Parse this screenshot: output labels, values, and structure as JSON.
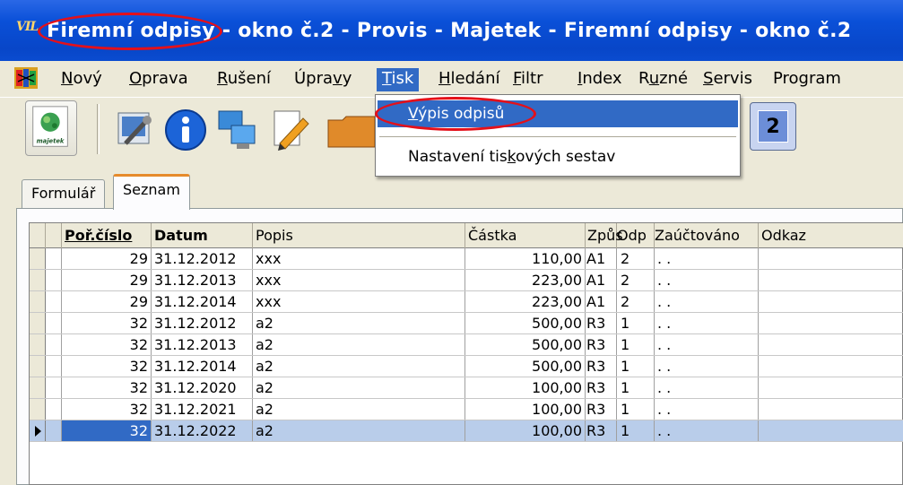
{
  "window": {
    "icon_text": "VIL",
    "title": "Firemní odpisy - okno č.2 - Provis - Majetek - Firemní odpisy - okno č.2"
  },
  "menubar": {
    "items": [
      {
        "label": "Nový"
      },
      {
        "label": "Oprava"
      },
      {
        "label": "Rušení"
      },
      {
        "label": "Úpravy"
      },
      {
        "label": "Tisk"
      },
      {
        "label": "Hledání"
      },
      {
        "label": "Filtr"
      },
      {
        "label": "Index"
      },
      {
        "label": "Ruzné"
      },
      {
        "label": "Servis"
      },
      {
        "label": "Program"
      }
    ],
    "active": "Tisk"
  },
  "dropdown": {
    "items": [
      {
        "label": "Výpis odpisů"
      },
      {
        "label": "Nastavení tiskových sestav"
      }
    ]
  },
  "toolbar": {
    "logo_text": "majetek",
    "window_number": "2"
  },
  "tabs": [
    {
      "label": "Formulář"
    },
    {
      "label": "Seznam"
    }
  ],
  "grid": {
    "columns": [
      "Poř.číslo",
      "Datum",
      "Popis",
      "Částka",
      "Způs",
      "Odp",
      "Zaúčtováno",
      "Odkaz"
    ],
    "rows": [
      {
        "cislo": "29",
        "datum": "31.12.2012",
        "popis": "xxx",
        "castka": "110,00",
        "zpus": "A1",
        "odp": "2",
        "zauct": ". ."
      },
      {
        "cislo": "29",
        "datum": "31.12.2013",
        "popis": "xxx",
        "castka": "223,00",
        "zpus": "A1",
        "odp": "2",
        "zauct": ". ."
      },
      {
        "cislo": "29",
        "datum": "31.12.2014",
        "popis": "xxx",
        "castka": "223,00",
        "zpus": "A1",
        "odp": "2",
        "zauct": ". ."
      },
      {
        "cislo": "32",
        "datum": "31.12.2012",
        "popis": "a2",
        "castka": "500,00",
        "zpus": "R3",
        "odp": "1",
        "zauct": ". ."
      },
      {
        "cislo": "32",
        "datum": "31.12.2013",
        "popis": "a2",
        "castka": "500,00",
        "zpus": "R3",
        "odp": "1",
        "zauct": ". ."
      },
      {
        "cislo": "32",
        "datum": "31.12.2014",
        "popis": "a2",
        "castka": "500,00",
        "zpus": "R3",
        "odp": "1",
        "zauct": ". ."
      },
      {
        "cislo": "32",
        "datum": "31.12.2020",
        "popis": "a2",
        "castka": "100,00",
        "zpus": "R3",
        "odp": "1",
        "zauct": ". ."
      },
      {
        "cislo": "32",
        "datum": "31.12.2021",
        "popis": "a2",
        "castka": "100,00",
        "zpus": "R3",
        "odp": "1",
        "zauct": ". ."
      },
      {
        "cislo": "32",
        "datum": "31.12.2022",
        "popis": "a2",
        "castka": "100,00",
        "zpus": "R3",
        "odp": "1",
        "zauct": ". .",
        "selected": true
      }
    ]
  },
  "colors": {
    "titlebar": "#0a50d8",
    "selection": "#316ac5",
    "highlight_ellipse": "#e4101a"
  }
}
